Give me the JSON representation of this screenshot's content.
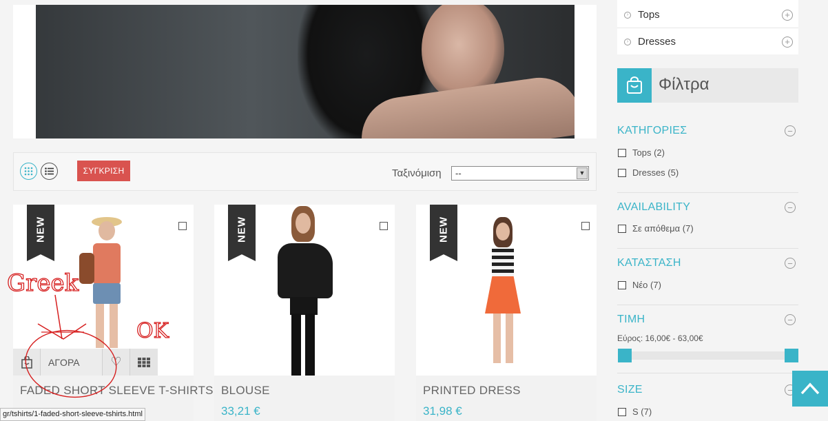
{
  "sidebar": {
    "categories": [
      {
        "label": "Tops"
      },
      {
        "label": "Dresses"
      }
    ],
    "filter_title": "Φίλτρα",
    "sections": {
      "categories": {
        "title": "ΚΑΤΗΓΟΡΙΕΣ",
        "options": [
          "Tops (2)",
          "Dresses (5)"
        ]
      },
      "availability": {
        "title": "AVAILABILITY",
        "options": [
          "Σε απόθεμα (7)"
        ]
      },
      "condition": {
        "title": "ΚΑΤΑΣΤΑΣΗ",
        "options": [
          "Νέο (7)"
        ]
      },
      "price": {
        "title": "ΤΙΜΗ",
        "range_text": "Εύρος: 16,00€ - 63,00€"
      },
      "size": {
        "title": "SIZE",
        "options": [
          "S (7)"
        ]
      }
    }
  },
  "toolbar": {
    "compare_label": "ΣΥΓΚΡΙΣΗ",
    "sort_label": "Ταξινόμιση",
    "sort_value": "--"
  },
  "products": [
    {
      "badge": "NEW",
      "name": "FADED SHORT SLEEVE T-SHIRTS",
      "price": ""
    },
    {
      "badge": "NEW",
      "name": "BLOUSE",
      "price": "33,21 €"
    },
    {
      "badge": "NEW",
      "name": "PRINTED DRESS",
      "price": "31,98 €"
    }
  ],
  "hover_bar": {
    "buy_label": "ΑΓΟΡΑ"
  },
  "annotations": {
    "text1": "Greek",
    "text2": "OK"
  },
  "status_bar": {
    "url": "gr/tshirts/1-faded-short-sleeve-tshirts.html"
  },
  "colors": {
    "accent": "#3ab4c8",
    "compare": "#d9534f"
  }
}
